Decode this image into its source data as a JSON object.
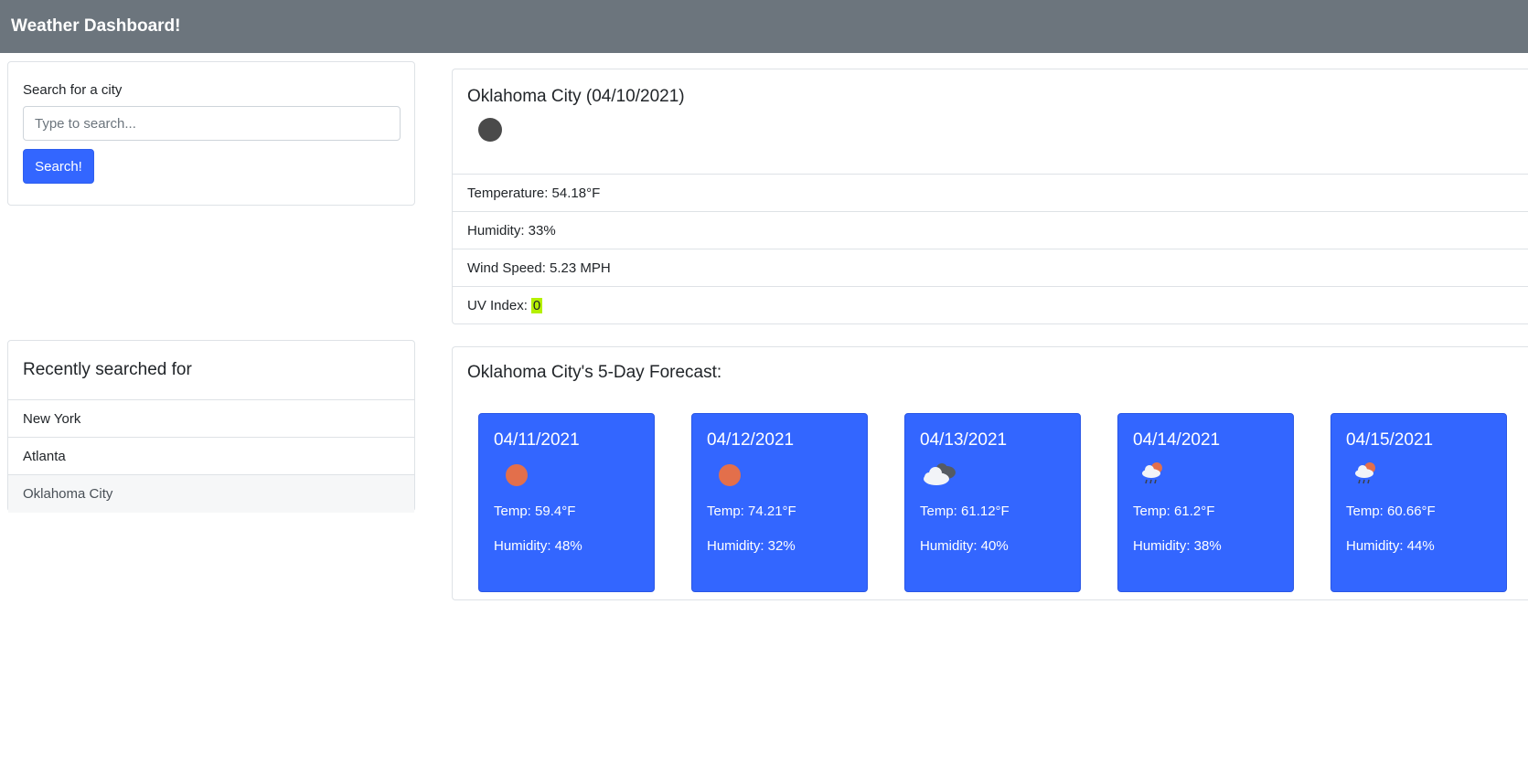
{
  "navbar": {
    "title": "Weather Dashboard!"
  },
  "search": {
    "label": "Search for a city",
    "placeholder": "Type to search...",
    "button_label": "Search!"
  },
  "current": {
    "title": "Oklahoma City (04/10/2021)",
    "icon": "moon-icon",
    "temperature": "Temperature: 54.18°F",
    "humidity": "Humidity: 33%",
    "wind": "Wind Speed: 5.23 MPH",
    "uv_label": "UV Index:",
    "uv_value": "0",
    "uv_color": "#b5f000"
  },
  "recent": {
    "title": "Recently searched for",
    "items": [
      {
        "label": "New York"
      },
      {
        "label": "Atlanta"
      },
      {
        "label": "Oklahoma City"
      }
    ]
  },
  "forecast": {
    "title": "Oklahoma City's 5-Day Forecast:",
    "days": [
      {
        "date": "04/11/2021",
        "icon": "sun-icon",
        "temp": "Temp: 59.4°F",
        "humidity": "Humidity: 48%"
      },
      {
        "date": "04/12/2021",
        "icon": "sun-icon",
        "temp": "Temp: 74.21°F",
        "humidity": "Humidity: 32%"
      },
      {
        "date": "04/13/2021",
        "icon": "clouds-icon",
        "temp": "Temp: 61.12°F",
        "humidity": "Humidity: 40%"
      },
      {
        "date": "04/14/2021",
        "icon": "rain-sun-icon",
        "temp": "Temp: 61.2°F",
        "humidity": "Humidity: 38%"
      },
      {
        "date": "04/15/2021",
        "icon": "rain-sun-icon",
        "temp": "Temp: 60.66°F",
        "humidity": "Humidity: 44%"
      }
    ]
  },
  "colors": {
    "navbar": "#6c757d",
    "accent": "#3366ff",
    "sun": "#e36f4b"
  }
}
